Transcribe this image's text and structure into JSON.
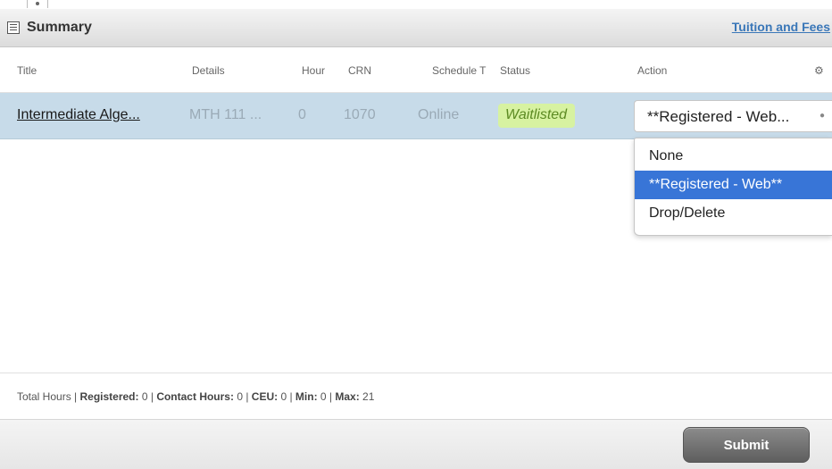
{
  "panel": {
    "title": "Summary",
    "tuition_link": "Tuition and Fees"
  },
  "columns": {
    "title": "Title",
    "details": "Details",
    "hours": "Hour",
    "crn": "CRN",
    "schedule": "Schedule T",
    "status": "Status",
    "action": "Action"
  },
  "row": {
    "title": "Intermediate Alge...",
    "details": "MTH 111 ...",
    "hours": "0",
    "crn": "1070",
    "schedule": "Online",
    "status": "Waitlisted",
    "action_selected": "**Registered - Web..."
  },
  "action_options": [
    "None",
    "**Registered - Web**",
    "Drop/Delete"
  ],
  "action_highlighted_index": 1,
  "footer": {
    "total_hours_label": "Total Hours | ",
    "registered_label": "Registered:",
    "registered_value": " 0 | ",
    "contact_label": "Contact Hours:",
    "contact_value": " 0 | ",
    "ceu_label": "CEU:",
    "ceu_value": " 0 | ",
    "min_label": "Min:",
    "min_value": " 0 | ",
    "max_label": "Max:",
    "max_value": " 21"
  },
  "buttons": {
    "submit": "Submit"
  },
  "colors": {
    "row_bg": "#c7dbe9",
    "status_badge_bg": "#d7f2a1",
    "selected_option_bg": "#3875d7",
    "link": "#3a77b8"
  }
}
